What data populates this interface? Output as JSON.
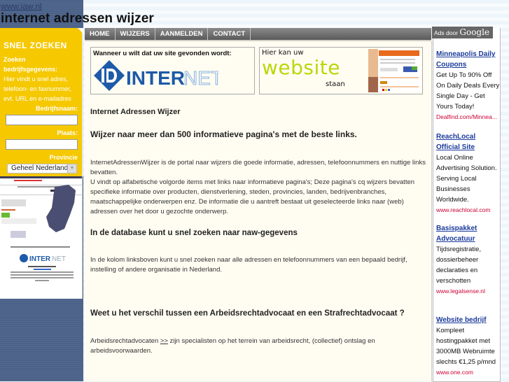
{
  "header": {
    "site_url": "www.iaw.nl",
    "site_title": "internet adressen wijzer"
  },
  "nav": {
    "items": [
      {
        "label": "HOME"
      },
      {
        "label": "WIJZERS"
      },
      {
        "label": "AANMELDEN"
      },
      {
        "label": "CONTACT"
      }
    ]
  },
  "search": {
    "title": "SNEL ZOEKEN",
    "subtitle_line1": "Zoeken",
    "subtitle_line2": "bedrijfsgegevens:",
    "description": "Hier vindt u snel adres, telefoon- en faxnummer, evt. URL en e-mailadres",
    "company_label": "Bedrijfsnaam:",
    "company_value": "",
    "place_label": "Plaats:",
    "place_value": "",
    "province_label": "Provincie",
    "province_selected": "Geheel Nederland"
  },
  "banners": {
    "left_caption": "Wanneer u wilt dat uw site gevonden wordt:",
    "left_logo_bold": "INTER",
    "left_logo_light": "NET",
    "left_logo_mark": "ID",
    "right_line1": "Hier kan uw",
    "right_big": "website",
    "right_line3": "staan"
  },
  "content": {
    "title": "Internet Adressen Wijzer",
    "subtitle": "Wijzer naar meer dan 500 informatieve pagina's met de beste links.",
    "para1": "InternetAdressenWijzer is de portal naar wijzers die goede informatie, adressen, telefoonnummers en nuttige links bevatten.",
    "para2": "U vindt op alfabetische volgorde items met links naar informatieve pagina's; Deze pagina's cq wijzers bevatten specifieke informatie over producten, dienstverlening, steden, provincies, landen, bedrijvenbranches, maatschappelijke onderwerpen enz. De informatie die u aantreft bestaat uit geselecteerde links naar (web) adressen over het door u gezochte onderwerp.",
    "heading2": "In de database kunt u snel zoeken naar naw-gegevens",
    "para3": "In de kolom linksboven kunt u snel zoeken naar alle adressen en telefoonnummers van een bepaald bedrijf, instelling of andere organisatie in Nederland.",
    "heading3": "Weet u het verschil tussen een Arbeidsrechtadvocaat en een Strafrechtadvocaat ?",
    "para4_before": "Arbeidsrechtadvocaten ",
    "para4_link": ">>",
    "para4_after": " zijn specialisten op het terrein van arbeidsrecht, (collectief) ontslag en arbeidsvoorwaarden."
  },
  "ads": {
    "header_prefix": "Ads door ",
    "header_brand": "Google",
    "items": [
      {
        "title": "Minneapolis Daily Coupons",
        "body": "Get Up To 90% Off On Daily Deals Every Single Day - Get Yours Today!",
        "url": "Dealfind.com/Minnea..."
      },
      {
        "title": "ReachLocal Official Site",
        "body": "Local Online Advertising Solution. Serving Local Businesses Worldwide.",
        "url": "www.reachlocal.com"
      },
      {
        "title": "Basispakket Advocatuur",
        "body": "Tijdsregistratie, dossierbeheer declaraties en verschotten",
        "url": "www.legalsense.nl"
      },
      {
        "title": "Website bedrijf",
        "body": "Kompleet hostingpakket met 3000MB Webruimte slechts €1,25 p/mnd",
        "url": "www.one.com"
      }
    ]
  },
  "colors": {
    "accent_yellow": "#f5c800",
    "sidebar_blue": "#4a628a",
    "ad_title": "#1a3a9a",
    "ad_url": "#cc0033"
  }
}
